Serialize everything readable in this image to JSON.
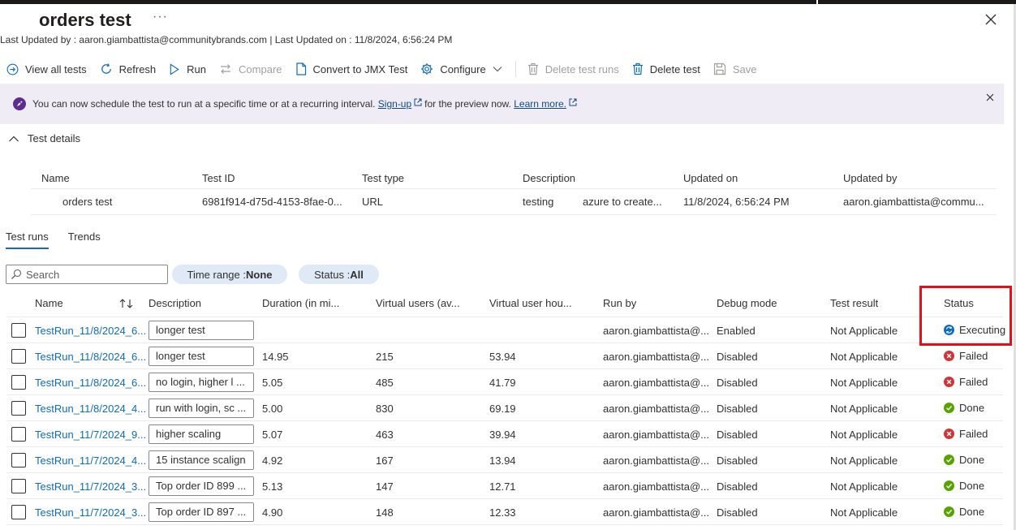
{
  "page": {
    "title": "orders test",
    "more_label": "···",
    "subtitle": "Last Updated by : aaron.giambattista@communitybrands.com | Last Updated on : 11/8/2024, 6:56:24 PM"
  },
  "toolbar": {
    "view_all": "View all tests",
    "refresh": "Refresh",
    "run": "Run",
    "compare": "Compare",
    "convert": "Convert to JMX Test",
    "configure": "Configure",
    "delete_runs": "Delete test runs",
    "delete_test": "Delete test",
    "save": "Save"
  },
  "banner": {
    "text_before": "You can now schedule the test to run at a specific time or at a recurring interval.",
    "signup_link": "Sign-up",
    "text_middle": "for the preview now.",
    "learn_link": "Learn more."
  },
  "details": {
    "section_label": "Test details",
    "headers": [
      "Name",
      "Test ID",
      "Test type",
      "Description",
      "Updated on",
      "Updated by"
    ],
    "row": {
      "name": "orders test",
      "test_id": "6981f914-d75d-4153-8fae-0...",
      "type": "URL",
      "desc_1": "testing",
      "desc_2": "azure to create...",
      "updated_on": "11/8/2024, 6:56:24 PM",
      "updated_by": "aaron.giambattista@commu..."
    }
  },
  "tabs": [
    "Test runs",
    "Trends"
  ],
  "filters": {
    "search_placeholder": "Search",
    "time_label": "Time range : ",
    "time_value": "None",
    "status_label": "Status : ",
    "status_value": "All"
  },
  "grid": {
    "headers": [
      "Name",
      "Description",
      "Duration (in mi...",
      "Virtual users (av...",
      "Virtual user hou...",
      "Run by",
      "Debug mode",
      "Test result",
      "Status"
    ],
    "rows": [
      {
        "name": "TestRun_11/8/2024_6...",
        "desc": "longer test",
        "duration": "",
        "vusers": "",
        "vhours": "",
        "run_by": "aaron.giambattista@...",
        "debug": "Enabled",
        "result": "Not Applicable",
        "status": "Executing",
        "status_kind": "executing"
      },
      {
        "name": "TestRun_11/8/2024_6...",
        "desc": "longer test",
        "duration": "14.95",
        "vusers": "215",
        "vhours": "53.94",
        "run_by": "aaron.giambattista@...",
        "debug": "Disabled",
        "result": "Not Applicable",
        "status": "Failed",
        "status_kind": "failed"
      },
      {
        "name": "TestRun_11/8/2024_6...",
        "desc": "no login, higher l ...",
        "duration": "5.05",
        "vusers": "485",
        "vhours": "41.79",
        "run_by": "aaron.giambattista@...",
        "debug": "Disabled",
        "result": "Not Applicable",
        "status": "Failed",
        "status_kind": "failed"
      },
      {
        "name": "TestRun_11/8/2024_4...",
        "desc": "run with login, sc ...",
        "duration": "5.00",
        "vusers": "830",
        "vhours": "69.19",
        "run_by": "aaron.giambattista@...",
        "debug": "Disabled",
        "result": "Not Applicable",
        "status": "Done",
        "status_kind": "done"
      },
      {
        "name": "TestRun_11/7/2024_9...",
        "desc": "higher scaling",
        "duration": "5.07",
        "vusers": "463",
        "vhours": "39.94",
        "run_by": "aaron.giambattista@...",
        "debug": "Disabled",
        "result": "Not Applicable",
        "status": "Failed",
        "status_kind": "failed"
      },
      {
        "name": "TestRun_11/7/2024_4...",
        "desc": "15 instance scalign",
        "duration": "4.92",
        "vusers": "167",
        "vhours": "13.94",
        "run_by": "aaron.giambattista@...",
        "debug": "Disabled",
        "result": "Not Applicable",
        "status": "Done",
        "status_kind": "done"
      },
      {
        "name": "TestRun_11/7/2024_3...",
        "desc": "Top order ID 899 ...",
        "duration": "5.13",
        "vusers": "147",
        "vhours": "12.71",
        "run_by": "aaron.giambattista@...",
        "debug": "Disabled",
        "result": "Not Applicable",
        "status": "Done",
        "status_kind": "done"
      },
      {
        "name": "TestRun_11/7/2024_3...",
        "desc": "Top order ID 897 ...",
        "duration": "4.90",
        "vusers": "148",
        "vhours": "12.33",
        "run_by": "aaron.giambattista@...",
        "debug": "Disabled",
        "result": "Not Applicable",
        "status": "Done",
        "status_kind": "done"
      }
    ]
  },
  "colors": {
    "accent": "#0f6cbd",
    "banner_bg": "#f0ecf5",
    "pill_bg": "#dfeaf6",
    "failed": "#d13438",
    "done": "#57a300",
    "executing": "#0f6cbd",
    "highlight": "#e3101a"
  }
}
